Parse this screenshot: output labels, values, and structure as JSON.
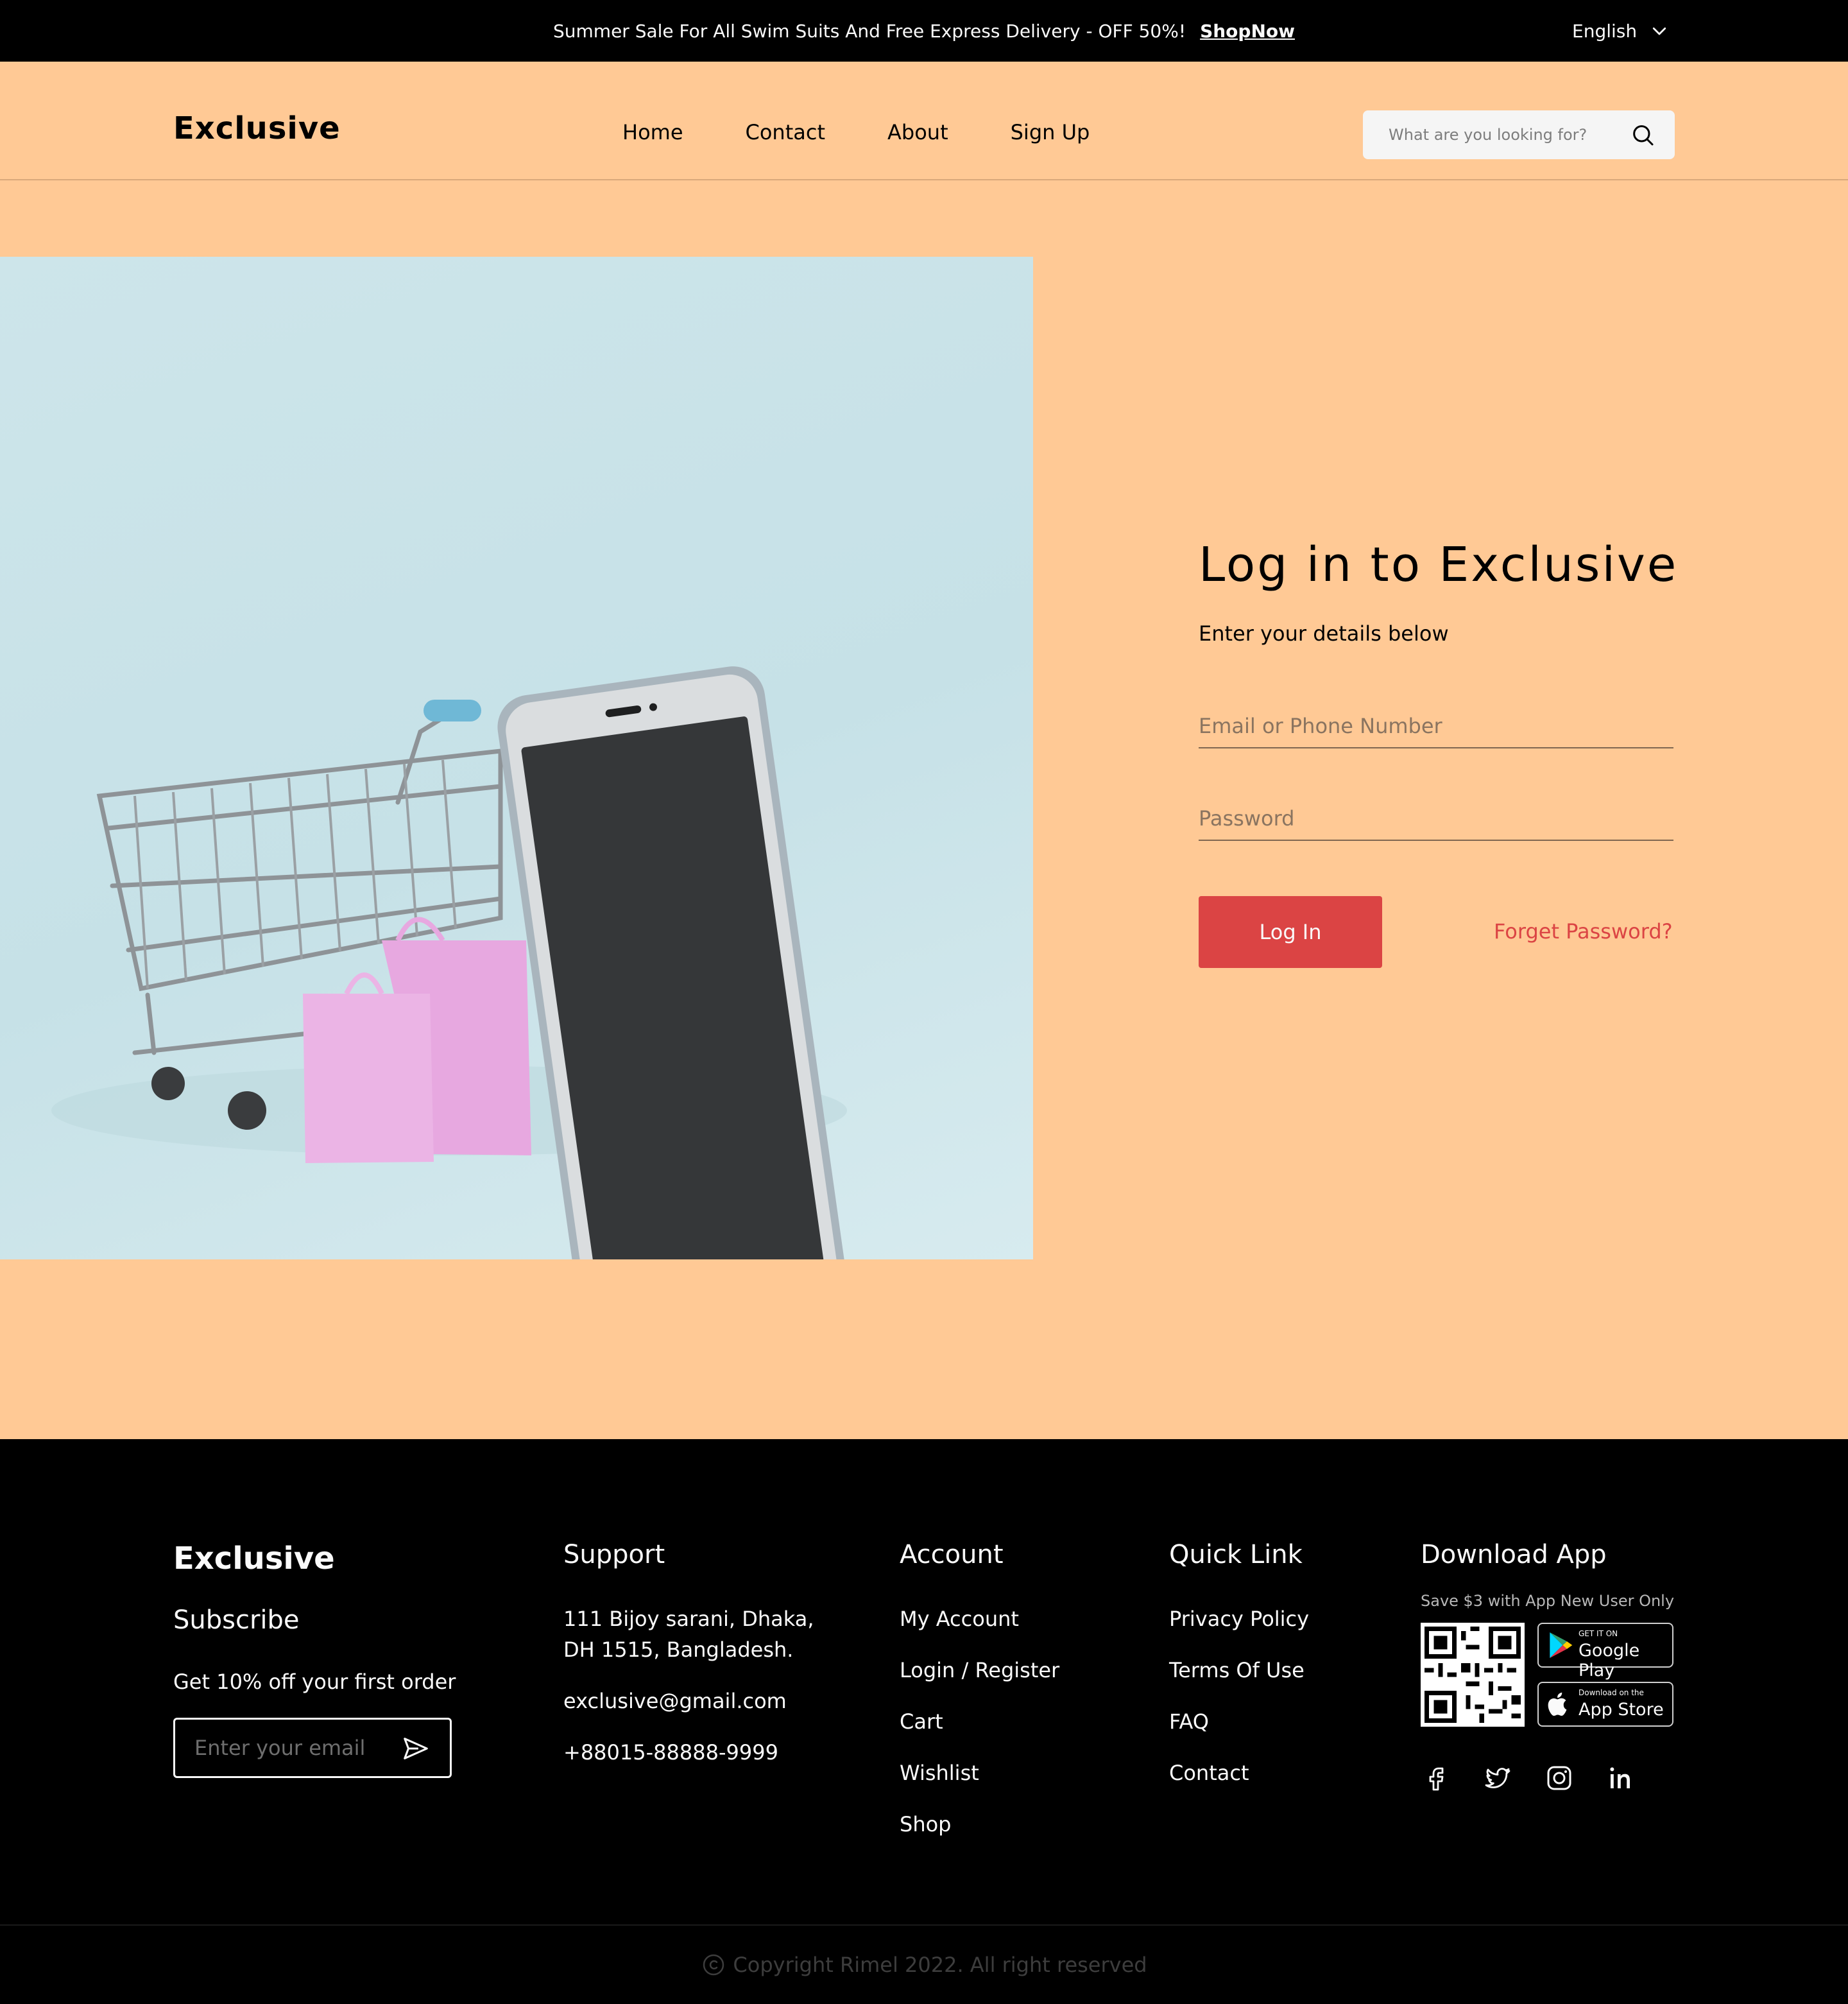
{
  "topbar": {
    "promo_text": "Summer Sale For All Swim Suits And Free Express Delivery - OFF 50%!",
    "shop_link": "ShopNow",
    "language": "English"
  },
  "header": {
    "logo": "Exclusive",
    "nav": [
      "Home",
      "Contact",
      "About",
      "Sign Up"
    ],
    "search_placeholder": "What are you looking for?"
  },
  "login": {
    "title": "Log in to Exclusive",
    "subtitle": "Enter your details below",
    "email_placeholder": "Email or Phone Number",
    "password_placeholder": "Password",
    "login_button": "Log In",
    "forgot_link": "Forget Password?"
  },
  "footer": {
    "brand": {
      "logo": "Exclusive",
      "subscribe": "Subscribe",
      "offer": "Get 10% off your first order",
      "email_placeholder": "Enter your email"
    },
    "support": {
      "title": "Support",
      "address_line1": "111 Bijoy sarani, Dhaka,",
      "address_line2": "DH 1515, Bangladesh.",
      "email": "exclusive@gmail.com",
      "phone": "+88015-88888-9999"
    },
    "account": {
      "title": "Account",
      "items": [
        "My Account",
        "Login / Register",
        "Cart",
        "Wishlist",
        "Shop"
      ]
    },
    "quick_link": {
      "title": "Quick Link",
      "items": [
        "Privacy Policy",
        "Terms Of Use",
        "FAQ",
        "Contact"
      ]
    },
    "download": {
      "title": "Download App",
      "save_text": "Save $3 with App New User Only",
      "google_small": "GET IT ON",
      "google_big": "Google Play",
      "apple_small": "Download on the",
      "apple_big": "App Store"
    },
    "copyright": "Copyright Rimel 2022. All right reserved"
  },
  "colors": {
    "accent": "#DB4444",
    "background": "#FFC995",
    "footer": "#000000"
  }
}
